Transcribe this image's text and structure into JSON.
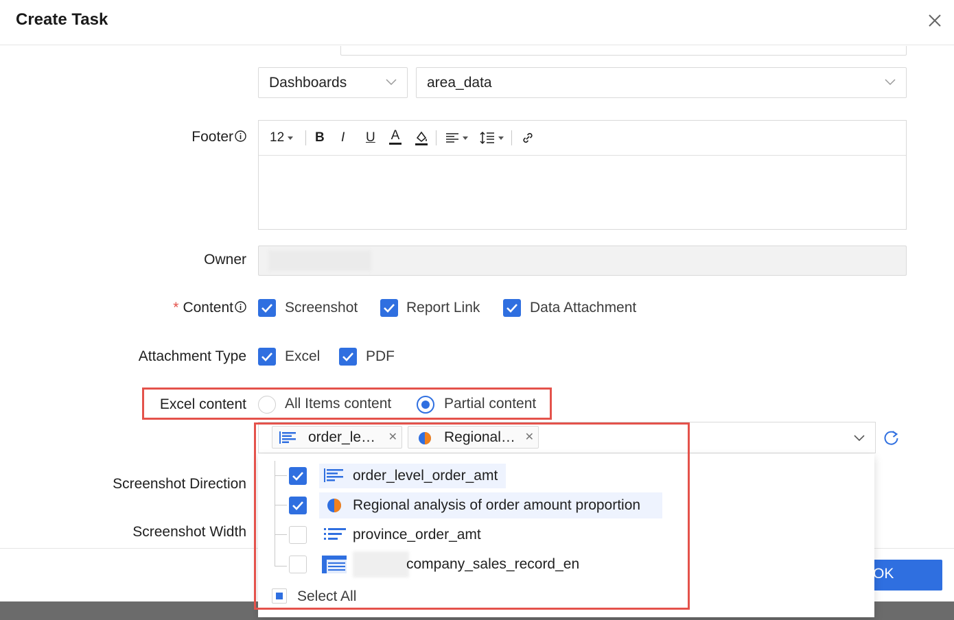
{
  "dialog": {
    "title": "Create Task",
    "close_icon": "close-icon"
  },
  "report_source": {
    "type_value": "Dashboards",
    "report_value": "area_data"
  },
  "footer": {
    "label": "Footer",
    "toolbar": {
      "font_size": "12",
      "bold": "B",
      "italic": "I",
      "underline": "U",
      "font_color": "A"
    }
  },
  "owner": {
    "label": "Owner"
  },
  "content": {
    "required_mark": "*",
    "label": "Content",
    "options": [
      {
        "label": "Screenshot",
        "checked": true
      },
      {
        "label": "Report Link",
        "checked": true
      },
      {
        "label": "Data Attachment",
        "checked": true
      }
    ]
  },
  "attachment_type": {
    "label": "Attachment Type",
    "options": [
      {
        "label": "Excel",
        "checked": true
      },
      {
        "label": "PDF",
        "checked": true
      }
    ]
  },
  "excel_content": {
    "label": "Excel content",
    "options": [
      {
        "label": "All Items content",
        "selected": false
      },
      {
        "label": "Partial content",
        "selected": true
      }
    ]
  },
  "selected_tags": [
    {
      "label": "order_le…",
      "icon": "bar-chart-icon"
    },
    {
      "label": "Regional…",
      "icon": "pie-chart-icon"
    }
  ],
  "screenshot_direction": {
    "label": "Screenshot Direction"
  },
  "screenshot_width": {
    "label": "Screenshot Width"
  },
  "dropdown": {
    "items": [
      {
        "label": "order_level_order_amt",
        "checked": true,
        "icon": "bar-chart-icon"
      },
      {
        "label": "Regional analysis of order amount proportion",
        "checked": true,
        "icon": "pie-chart-icon"
      },
      {
        "label": "province_order_amt",
        "checked": false,
        "icon": "ranking-list-icon"
      },
      {
        "label": "company_sales_record_en",
        "checked": false,
        "icon": "table-icon"
      }
    ],
    "select_all": "Select All"
  },
  "ok_button": "OK",
  "colors": {
    "primary": "#2f6fe0",
    "highlight_border": "#e4524b",
    "pie_orange": "#f2811d"
  }
}
